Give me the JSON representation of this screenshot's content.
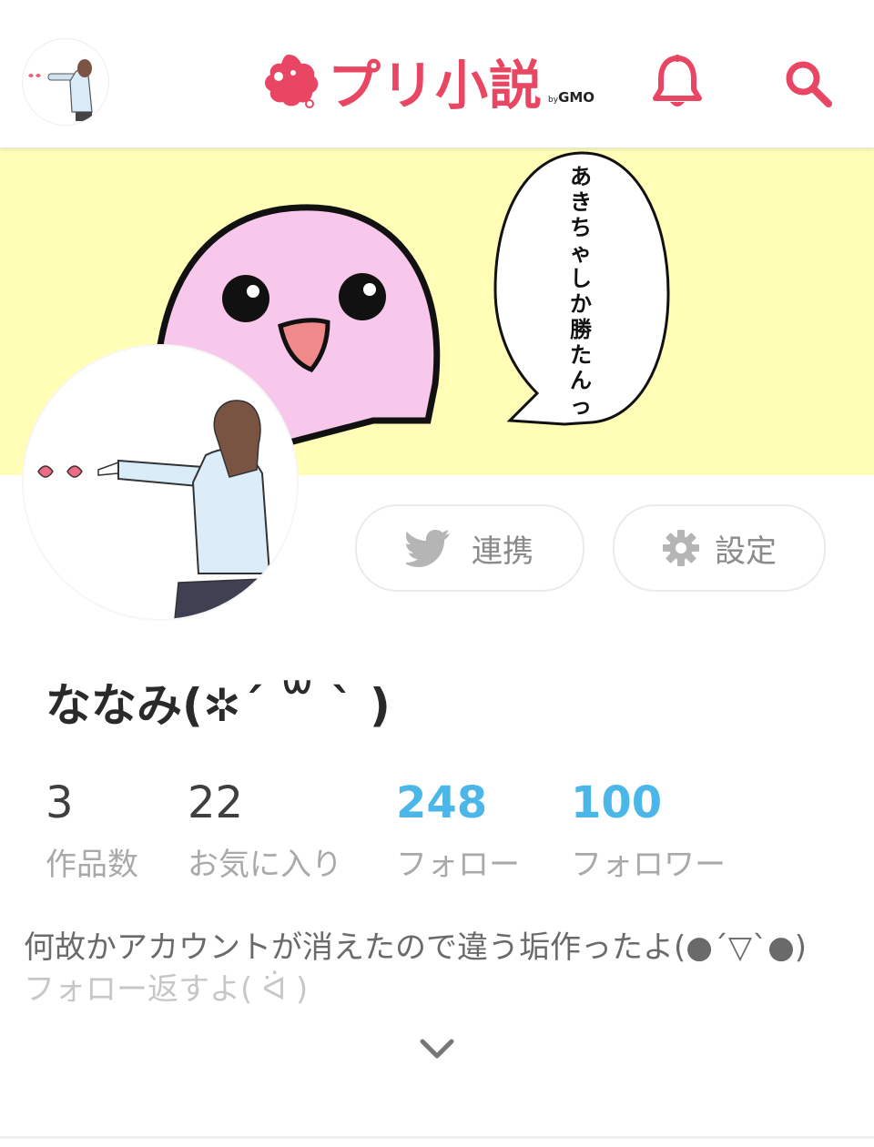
{
  "header": {
    "logo_text": "プリ小説",
    "logo_by": "by",
    "logo_brand": "GMO"
  },
  "cover": {
    "speech_bubble": "あきちゃしか勝たんっ"
  },
  "profile": {
    "name": "ななみ(✲´ ꒳ ` )",
    "link_button": "連携",
    "settings_button": "設定"
  },
  "stats": [
    {
      "value": "3",
      "label": "作品数"
    },
    {
      "value": "22",
      "label": "お気に入り"
    },
    {
      "value": "248",
      "label": "フォロー"
    },
    {
      "value": "100",
      "label": "フォロワー"
    }
  ],
  "bio": {
    "line1": "何故かアカウントが消えたので違う垢作ったよ(●´▽`●)",
    "line2": "フォロー返すよ( ᐛ )"
  },
  "colors": {
    "brand": "#e94663",
    "accent_blue": "#4ab7e8",
    "cover_bg": "#fffdb6",
    "blob_pink": "#f7c8ec"
  },
  "icons": [
    "avatar-small",
    "app-logo-icon",
    "bell-icon",
    "search-icon",
    "twitter-icon",
    "gear-icon",
    "chevron-down-icon"
  ]
}
